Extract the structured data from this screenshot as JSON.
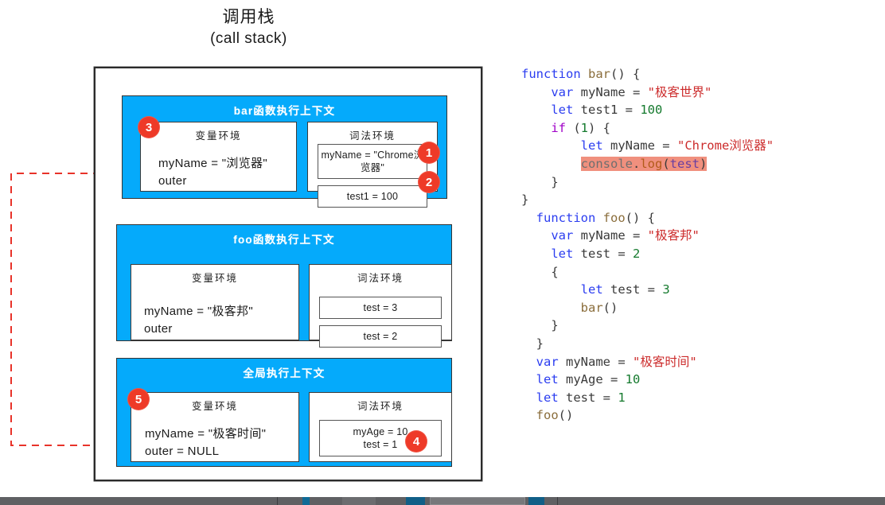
{
  "title": {
    "cn": "调用栈",
    "en": "(call stack)"
  },
  "colors": {
    "context_blue": "#05AAFB",
    "badge_red": "#EE3A28",
    "highlight_salmon": "#F0907E",
    "arrow_red": "#E8332A",
    "border_black": "#2b2b2b"
  },
  "stack": {
    "contexts": [
      {
        "name": "bar-context",
        "title": "bar函数执行上下文",
        "variable_env": {
          "heading": "变量环境",
          "lines": [
            "myName = \"浏览器\"",
            "outer"
          ],
          "badge": "3"
        },
        "lexical_env": {
          "heading": "词法环境",
          "items": [
            {
              "text": "myName = \"Chrome浏览器\"",
              "badge": "1"
            },
            {
              "text": "test1 = 100",
              "badge": "2"
            }
          ]
        }
      },
      {
        "name": "foo-context",
        "title": "foo函数执行上下文",
        "variable_env": {
          "heading": "变量环境",
          "lines": [
            "myName = \"极客邦\"",
            "outer"
          ],
          "badge": null
        },
        "lexical_env": {
          "heading": "词法环境",
          "items": [
            {
              "text": "test = 3",
              "badge": null
            },
            {
              "text": "test = 2",
              "badge": null
            }
          ]
        }
      },
      {
        "name": "global-context",
        "title": "全局执行上下文",
        "variable_env": {
          "heading": "变量环境",
          "lines": [
            "myName = \"极客时间\"",
            "outer = NULL"
          ],
          "badge": "5"
        },
        "lexical_env": {
          "heading": "词法环境",
          "items": [
            {
              "text": "myAge = 10\ntest = 1",
              "badge": "4"
            }
          ]
        }
      }
    ]
  },
  "code": {
    "lines": [
      [
        {
          "t": "function ",
          "c": "kw"
        },
        {
          "t": "bar",
          "c": "fn"
        },
        {
          "t": "() {",
          "c": "pl"
        }
      ],
      [
        {
          "t": "    var ",
          "c": "kw"
        },
        {
          "t": "myName = ",
          "c": "pl"
        },
        {
          "t": "\"极客世界\"",
          "c": "str"
        }
      ],
      [
        {
          "t": "    let ",
          "c": "kw"
        },
        {
          "t": "test1 = ",
          "c": "pl"
        },
        {
          "t": "100",
          "c": "num"
        }
      ],
      [
        {
          "t": "    if",
          "c": "kw2"
        },
        {
          "t": " (",
          "c": "pl"
        },
        {
          "t": "1",
          "c": "num"
        },
        {
          "t": ") {",
          "c": "pl"
        }
      ],
      [
        {
          "t": "        let ",
          "c": "kw"
        },
        {
          "t": "myName = ",
          "c": "pl"
        },
        {
          "t": "\"Chrome浏览器\"",
          "c": "str"
        }
      ],
      [
        {
          "t": "        ",
          "c": "pl"
        },
        {
          "t": "console",
          "c": "obj hl"
        },
        {
          "t": ".",
          "c": "pl hl"
        },
        {
          "t": "log",
          "c": "mtd hl"
        },
        {
          "t": "(",
          "c": "pl hl"
        },
        {
          "t": "test",
          "c": "arg hl"
        },
        {
          "t": ")",
          "c": "pl hl"
        }
      ],
      [
        {
          "t": "    }",
          "c": "pl"
        }
      ],
      [
        {
          "t": "}",
          "c": "pl"
        }
      ],
      [
        {
          "t": "  function ",
          "c": "kw"
        },
        {
          "t": "foo",
          "c": "fn"
        },
        {
          "t": "() {",
          "c": "pl"
        }
      ],
      [
        {
          "t": "    var ",
          "c": "kw"
        },
        {
          "t": "myName = ",
          "c": "pl"
        },
        {
          "t": "\"极客邦\"",
          "c": "str"
        }
      ],
      [
        {
          "t": "    let ",
          "c": "kw"
        },
        {
          "t": "test = ",
          "c": "pl"
        },
        {
          "t": "2",
          "c": "num"
        }
      ],
      [
        {
          "t": "    {",
          "c": "pl"
        }
      ],
      [
        {
          "t": "        let ",
          "c": "kw"
        },
        {
          "t": "test = ",
          "c": "pl"
        },
        {
          "t": "3",
          "c": "num"
        }
      ],
      [
        {
          "t": "        ",
          "c": "pl"
        },
        {
          "t": "bar",
          "c": "fn"
        },
        {
          "t": "()",
          "c": "pl"
        }
      ],
      [
        {
          "t": "    }",
          "c": "pl"
        }
      ],
      [
        {
          "t": "  }",
          "c": "pl"
        }
      ],
      [
        {
          "t": "  var ",
          "c": "kw"
        },
        {
          "t": "myName = ",
          "c": "pl"
        },
        {
          "t": "\"极客时间\"",
          "c": "str"
        }
      ],
      [
        {
          "t": "  let ",
          "c": "kw"
        },
        {
          "t": "myAge = ",
          "c": "pl"
        },
        {
          "t": "10",
          "c": "num"
        }
      ],
      [
        {
          "t": "  let ",
          "c": "kw"
        },
        {
          "t": "test = ",
          "c": "pl"
        },
        {
          "t": "1",
          "c": "num"
        }
      ],
      [
        {
          "t": "  ",
          "c": "pl"
        },
        {
          "t": "foo",
          "c": "fn"
        },
        {
          "t": "()",
          "c": "pl"
        }
      ]
    ]
  },
  "arrow": {
    "label": "outer-scope-chain-pointer",
    "from": "bar-context-outer",
    "to": "global-context"
  }
}
